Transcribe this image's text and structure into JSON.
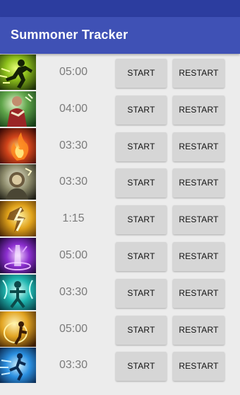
{
  "app": {
    "title": "Summoner Tracker"
  },
  "colors": {
    "status_bar": "#2c3d9f",
    "app_bar": "#3f51b5",
    "background": "#ececec",
    "button": "#d6d6d6",
    "timer_text": "#7b7b7b"
  },
  "spells": [
    {
      "icon": "ghost-spell-icon",
      "timer": "05:00",
      "start_label": "START",
      "restart_label": "RESTART"
    },
    {
      "icon": "heal-spell-icon",
      "timer": "04:00",
      "start_label": "START",
      "restart_label": "RESTART"
    },
    {
      "icon": "ignite-spell-icon",
      "timer": "03:30",
      "start_label": "START",
      "restart_label": "RESTART"
    },
    {
      "icon": "exhaust-spell-icon",
      "timer": "03:30",
      "start_label": "START",
      "restart_label": "RESTART"
    },
    {
      "icon": "smite-spell-icon",
      "timer": "1:15",
      "start_label": "START",
      "restart_label": "RESTART"
    },
    {
      "icon": "teleport-spell-icon",
      "timer": "05:00",
      "start_label": "START",
      "restart_label": "RESTART"
    },
    {
      "icon": "cleanse-spell-icon",
      "timer": "03:30",
      "start_label": "START",
      "restart_label": "RESTART"
    },
    {
      "icon": "flash-spell-icon",
      "timer": "05:00",
      "start_label": "START",
      "restart_label": "RESTART"
    },
    {
      "icon": "barrier-spell-icon",
      "timer": "03:30",
      "start_label": "START",
      "restart_label": "RESTART"
    }
  ]
}
